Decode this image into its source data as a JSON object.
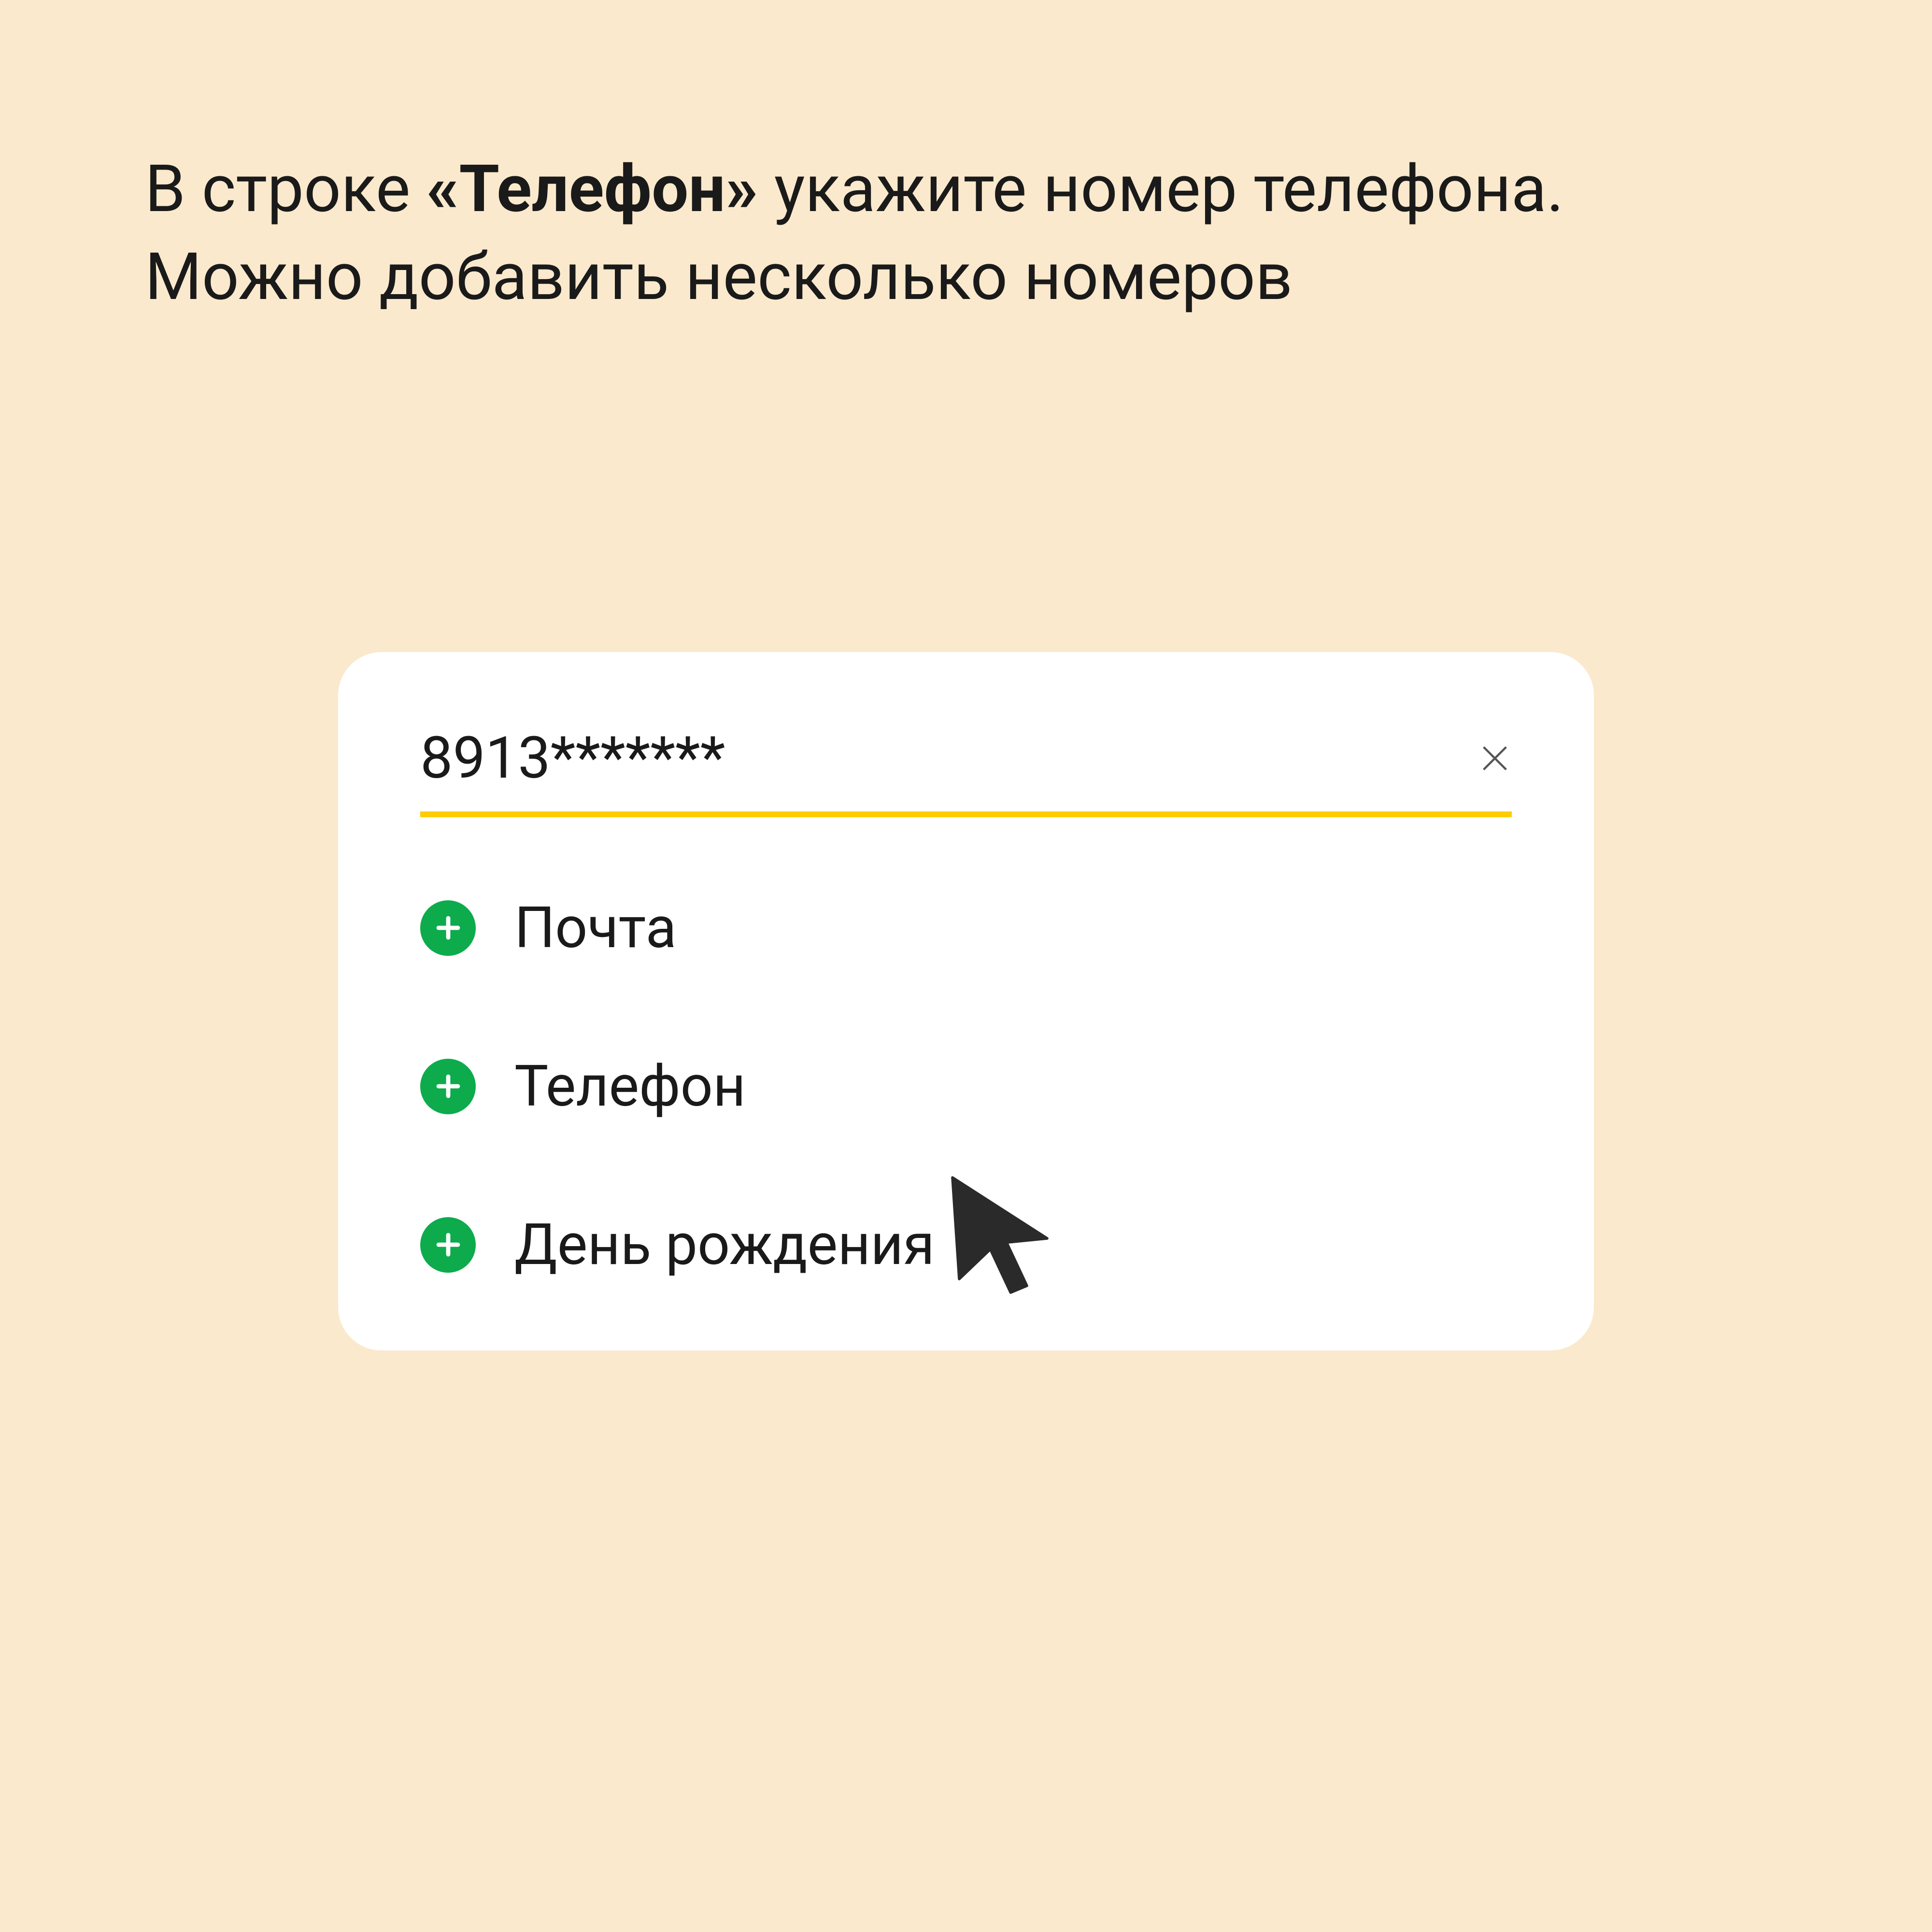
{
  "instruction": {
    "prefix": "В строке ",
    "bold": "«Телефон»",
    "suffix": " укажите номер телефона. Можно добавить несколько номеров"
  },
  "card": {
    "input_value": "8913*******",
    "options": [
      {
        "label": "Почта"
      },
      {
        "label": "Телефон"
      },
      {
        "label": "День рождения"
      }
    ]
  }
}
